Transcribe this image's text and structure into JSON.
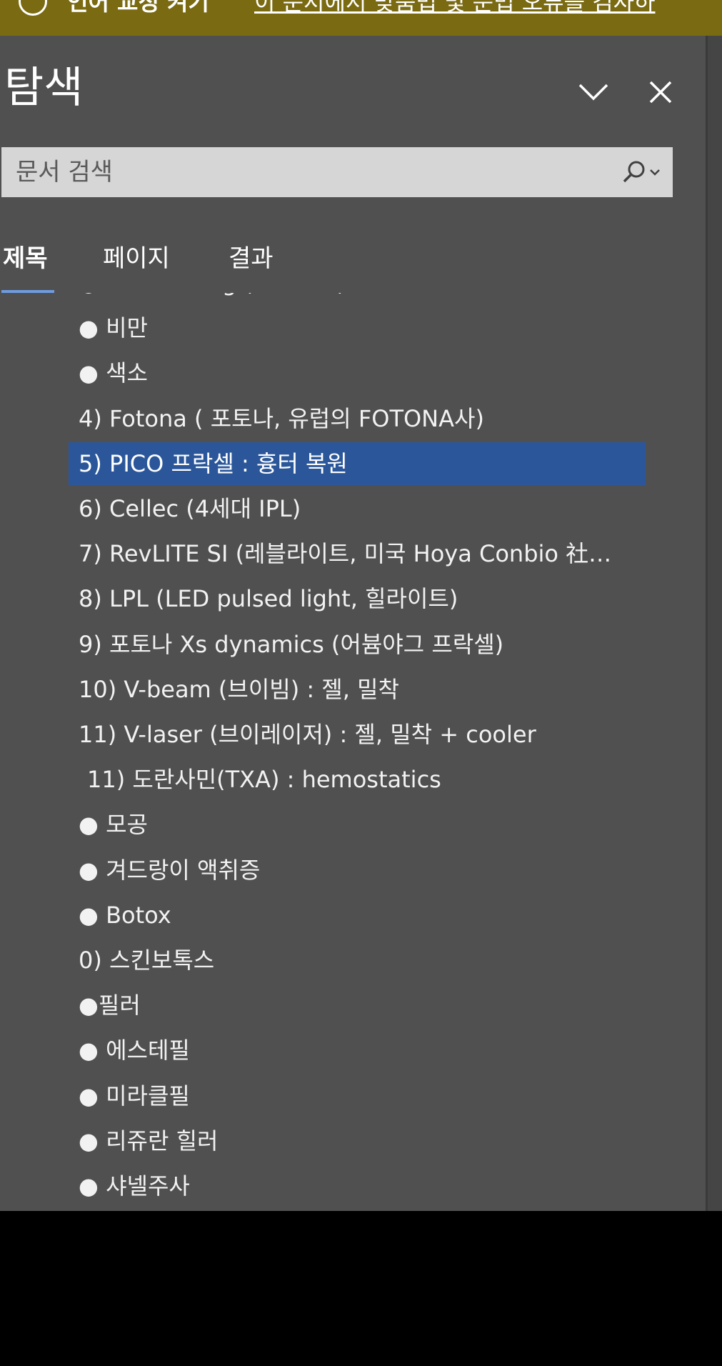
{
  "notice": {
    "title": "언어 교정 켜기",
    "link": "이 문서에서 맞춤법 및 문법 오류를 검사하"
  },
  "pane": {
    "title": "탐색"
  },
  "search": {
    "placeholder": "문서 검색"
  },
  "tabs": [
    {
      "label": "제목",
      "active": true
    },
    {
      "label": "페이지",
      "active": false
    },
    {
      "label": "결과",
      "active": false
    }
  ],
  "tree": {
    "selected_index": 4,
    "items": [
      "● Exilis lifting (익실리스) + 써마지",
      "● 비만",
      "● 색소",
      "4) Fotona ( 포토나, 유럽의 FOTONA사)",
      "5) PICO 프락셀 : 흉터 복원",
      "6) Cellec (4세대 IPL)",
      "7) RevLITE SI (레블라이트, 미국 Hoya Conbio 社…",
      "8) LPL (LED pulsed light, 힐라이트)",
      "9) 포토나 Xs dynamics (어븀야그 프락셀)",
      "10) V-beam (브이빔) : 젤, 밀착",
      "11) V-laser (브이레이저) : 젤, 밀착 + cooler",
      "11) 도란사민(TXA) : hemostatics",
      "● 모공",
      "● 겨드랑이 액취증",
      "● Botox",
      "0) 스킨보톡스",
      "●필러",
      "● 에스테필",
      "● 미라클필",
      "● 리쥬란 힐러",
      "● 샤넬주사"
    ]
  },
  "colors": {
    "pane_background": "#505050",
    "selection": "#2b579a",
    "tab_underline": "#6f9be0",
    "notice_background": "#7a6a12"
  }
}
